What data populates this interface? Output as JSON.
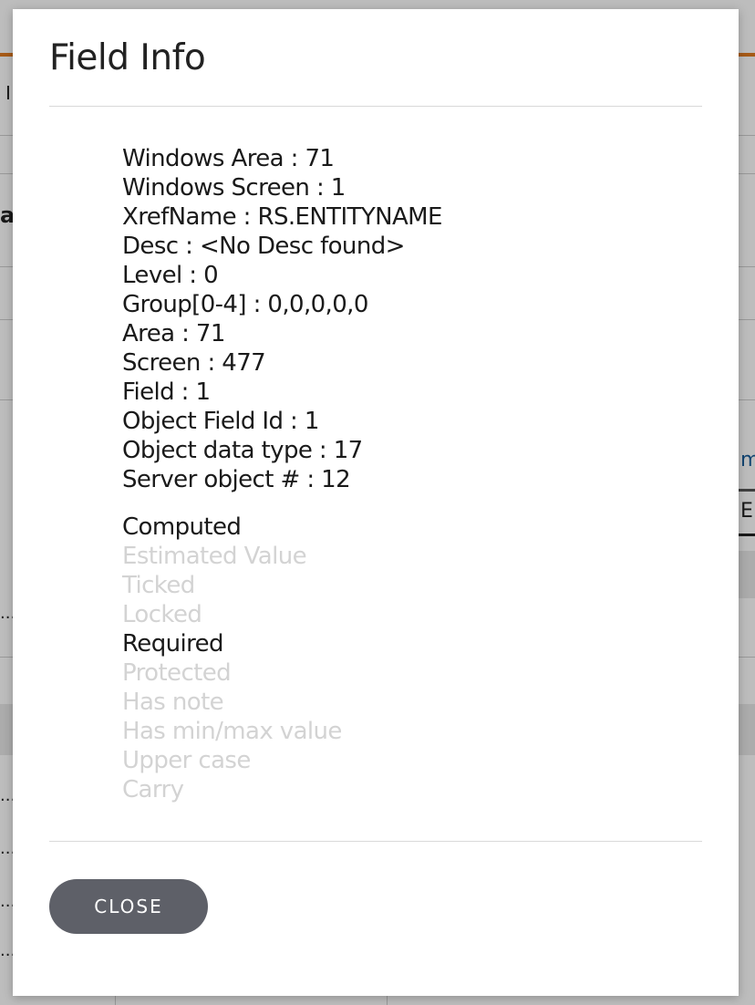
{
  "background": {
    "left_fragments": [
      "I",
      "a",
      "...",
      "...",
      "...",
      "...",
      "..."
    ],
    "right_fragments": [
      "m",
      "E"
    ]
  },
  "dialog": {
    "title": "Field Info",
    "info_lines": [
      "Windows Area : 71",
      "Windows Screen : 1",
      "XrefName : RS.ENTITYNAME",
      "Desc : <No Desc found>",
      "Level : 0",
      "Group[0-4] : 0,0,0,0,0",
      "Area : 71",
      "Screen : 477",
      "Field : 1",
      "Object Field Id : 1",
      "Object data type : 17",
      "Server object # : 12"
    ],
    "flags": [
      {
        "label": "Computed",
        "active": true
      },
      {
        "label": "Estimated Value",
        "active": false
      },
      {
        "label": "Ticked",
        "active": false
      },
      {
        "label": "Locked",
        "active": false
      },
      {
        "label": "Required",
        "active": true
      },
      {
        "label": "Protected",
        "active": false
      },
      {
        "label": "Has note",
        "active": false
      },
      {
        "label": "Has min/max value",
        "active": false
      },
      {
        "label": "Upper case",
        "active": false
      },
      {
        "label": "Carry",
        "active": false
      }
    ],
    "close_label": "CLOSE"
  },
  "colors": {
    "accent_orange": "#e07a20",
    "button_bg": "#5e6068",
    "flag_active": "#1a1a1a",
    "flag_inactive": "#d3d3d3"
  }
}
